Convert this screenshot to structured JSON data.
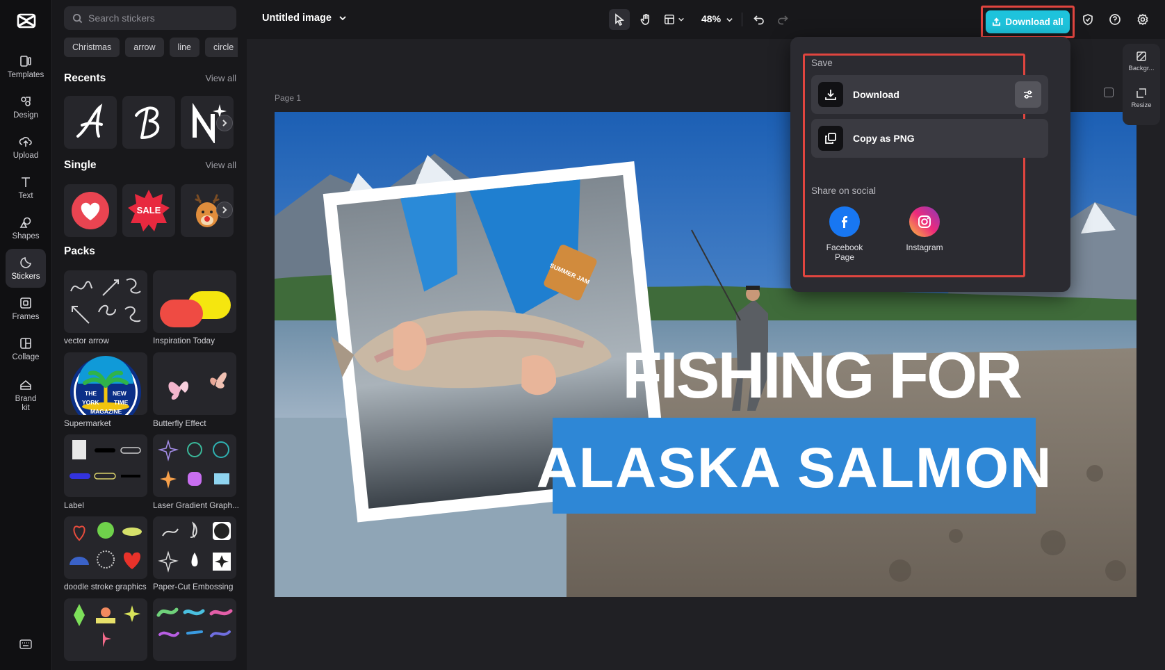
{
  "rail": {
    "items": [
      {
        "label": "Templates",
        "icon": "templates-icon"
      },
      {
        "label": "Design",
        "icon": "design-icon"
      },
      {
        "label": "Upload",
        "icon": "upload-icon"
      },
      {
        "label": "Text",
        "icon": "text-icon"
      },
      {
        "label": "Shapes",
        "icon": "shapes-icon"
      },
      {
        "label": "Stickers",
        "icon": "stickers-icon"
      },
      {
        "label": "Frames",
        "icon": "frames-icon"
      },
      {
        "label": "Collage",
        "icon": "collage-icon"
      },
      {
        "label": "Brand kit",
        "icon": "brand-kit-icon"
      }
    ],
    "active": "Stickers"
  },
  "panel": {
    "search_placeholder": "Search stickers",
    "chips": [
      "Christmas",
      "arrow",
      "line",
      "circle"
    ],
    "recents": {
      "title": "Recents",
      "view_all": "View all"
    },
    "single": {
      "title": "Single",
      "view_all": "View all",
      "sale_text": "SALE"
    },
    "packs": {
      "title": "Packs",
      "items": [
        "vector arrow",
        "Inspiration Today",
        "Supermarket",
        "Butterfly Effect",
        "Label",
        "Laser Gradient Graph...",
        "doodle stroke graphics",
        "Paper-Cut Embossing"
      ],
      "magazine_text": [
        "THE",
        "NEW",
        "YORK",
        "TIME",
        "MAGAZINE"
      ]
    }
  },
  "topbar": {
    "title": "Untitled image",
    "zoom": "48%",
    "download_all": "Download all"
  },
  "canvas": {
    "page_label": "Page 1",
    "headline_1": "FISHING FOR",
    "headline_2": "ALASKA SALMON",
    "badge_text": "SUMMER JAM"
  },
  "right_tools": {
    "background": "Backgr...",
    "resize": "Resize"
  },
  "dropdown": {
    "save_title": "Save",
    "download": "Download",
    "copy_png": "Copy as PNG",
    "share_title": "Share on social",
    "facebook": "Facebook Page",
    "instagram": "Instagram"
  },
  "colors": {
    "accent": "#1ec3dc",
    "highlight": "#e0453f",
    "banner": "#2e87d6"
  }
}
